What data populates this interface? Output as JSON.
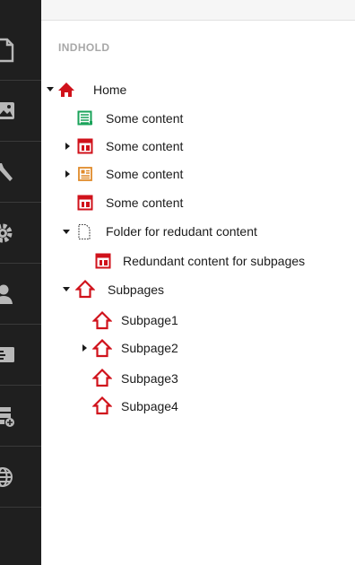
{
  "section": {
    "title": "INDHOLD"
  },
  "sidebar": {
    "items": [
      {
        "icon": "document-icon"
      },
      {
        "icon": "image-icon"
      },
      {
        "icon": "wrench-icon"
      },
      {
        "icon": "gear-icon"
      },
      {
        "icon": "user-icon"
      },
      {
        "icon": "contact-card-icon"
      },
      {
        "icon": "add-list-icon"
      },
      {
        "icon": "globe-icon"
      }
    ]
  },
  "tree": {
    "nodes": [
      {
        "label": "Home",
        "icon": "home-filled-icon",
        "caret": "down"
      },
      {
        "label": "Some content",
        "icon": "green-list-doc-icon",
        "caret": ""
      },
      {
        "label": "Some content",
        "icon": "red-layout-icon",
        "caret": "right"
      },
      {
        "label": "Some content",
        "icon": "orange-article-icon",
        "caret": "right"
      },
      {
        "label": "Some content",
        "icon": "red-layout-icon",
        "caret": ""
      },
      {
        "label": "Folder for redudant content",
        "icon": "dotted-document-icon",
        "caret": "down"
      },
      {
        "label": "Redundant content for subpages",
        "icon": "red-layout-icon",
        "caret": ""
      },
      {
        "label": "Subpages",
        "icon": "home-outline-icon",
        "caret": "down"
      },
      {
        "label": "Subpage1",
        "icon": "home-outline-icon",
        "caret": ""
      },
      {
        "label": "Subpage2",
        "icon": "home-outline-icon",
        "caret": "right"
      },
      {
        "label": "Subpage3",
        "icon": "home-outline-icon",
        "caret": ""
      },
      {
        "label": "Subpage4",
        "icon": "home-outline-icon",
        "caret": ""
      }
    ]
  },
  "colors": {
    "sidebar": "#1f1f1f",
    "accent_red": "#d0121b",
    "accent_green": "#1aa35a",
    "accent_orange": "#e08a2a"
  }
}
